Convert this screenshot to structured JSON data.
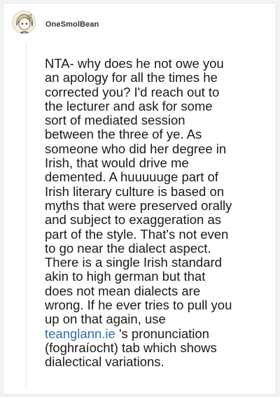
{
  "post": {
    "username": "OneSmolBean",
    "avatar_icon": "cartoon-avatar-icon",
    "comment": {
      "part1": "NTA- why does he not owe you\nan apology for all the times he\ncorrected you? I'd reach out to\nthe lecturer and ask for some\nsort of mediated session\nbetween the three of ye. As\nsomeone who did her degree in\nIrish, that would drive me\ndemented. A huuuuuge part of\nIrish literary culture is based on\nmyths that were preserved orally\nand subject to exaggeration as\npart of the style. That's not even\nto go near the dialect aspect.\nThere is a single Irish standard\nakin to high german but that\ndoes not mean dialects are\nwrong. If he ever tries to pull you\nup on that again, use\n",
      "link_text": "teanglann.ie",
      "part2": " 's pronunciation\n(foghraíocht) tab which shows\ndialectical variations."
    }
  },
  "colors": {
    "background": "#f3f3f3",
    "card": "#ffffff",
    "text": "#1a1a1a",
    "link": "#2f6fb7"
  }
}
